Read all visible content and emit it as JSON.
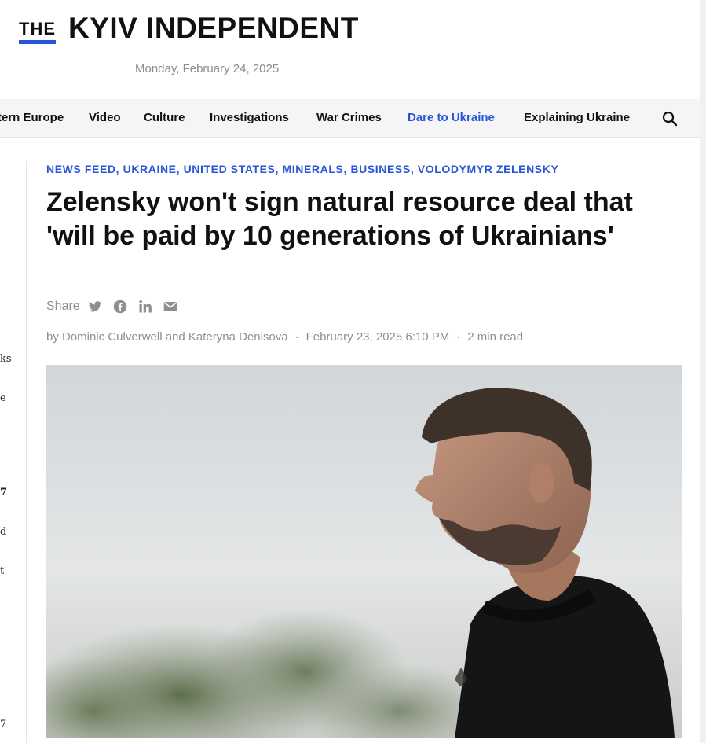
{
  "header": {
    "logo_the": "THE",
    "logo_name": "KYIV INDEPENDENT",
    "date": "Monday, February 24, 2025"
  },
  "nav": {
    "items": [
      {
        "label": "tern Europe"
      },
      {
        "label": "Video"
      },
      {
        "label": "Culture"
      },
      {
        "label": "Investigations"
      },
      {
        "label": "War Crimes"
      },
      {
        "label": "Dare to Ukraine"
      },
      {
        "label": "Explaining Ukraine"
      }
    ],
    "search_icon": "search-icon"
  },
  "left_rail": {
    "fragments": [
      "ks",
      "e",
      "7",
      "d",
      "t",
      "7"
    ]
  },
  "article": {
    "tags": [
      "NEWS FEED",
      "UKRAINE",
      "UNITED STATES",
      "MINERALS",
      "BUSINESS",
      "VOLODYMYR ZELENSKY"
    ],
    "headline": "Zelensky won't sign natural resource deal that 'will be paid by 10 generations of Ukrainians'",
    "share_label": "Share",
    "share_icons": [
      "twitter-icon",
      "facebook-icon",
      "linkedin-icon",
      "email-icon"
    ],
    "byline": {
      "authors": "by Dominic Culverwell and Kateryna Denisova",
      "date": "February 23, 2025 6:10 PM",
      "read_time": "2 min read"
    }
  },
  "colors": {
    "accent": "#2855d8",
    "text": "#111111",
    "muted": "#8f8f8f",
    "nav_bg": "#f5f5f5"
  }
}
